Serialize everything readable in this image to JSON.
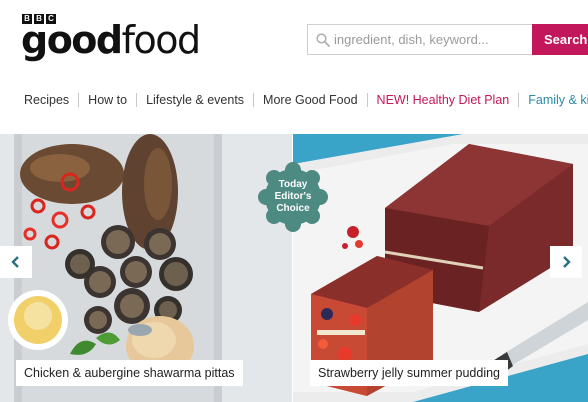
{
  "brand": {
    "bbc_letters": [
      "B",
      "B",
      "C"
    ],
    "word_bold": "good",
    "word_light": "food"
  },
  "search": {
    "placeholder": "ingredient, dish, keyword...",
    "button_label": "Search"
  },
  "nav": {
    "items": [
      {
        "label": "Recipes"
      },
      {
        "label": "How to"
      },
      {
        "label": "Lifestyle & events"
      },
      {
        "label": "More Good Food"
      },
      {
        "label": "NEW! Healthy Diet Plan"
      },
      {
        "label": "Family & kids"
      }
    ]
  },
  "carousel": {
    "badge": {
      "line1": "Today",
      "line2": "Editor's",
      "line3": "Choice"
    },
    "slides": [
      {
        "caption": "Chicken & aubergine shawarma pittas"
      },
      {
        "caption": "Strawberry jelly summer pudding"
      }
    ]
  },
  "colors": {
    "accent": "#c2185b",
    "teal_link": "#2a8aa8",
    "badge": "#4d8a82"
  },
  "icons": {
    "search": "search-icon",
    "prev": "chevron-left-icon",
    "next": "chevron-right-icon"
  }
}
